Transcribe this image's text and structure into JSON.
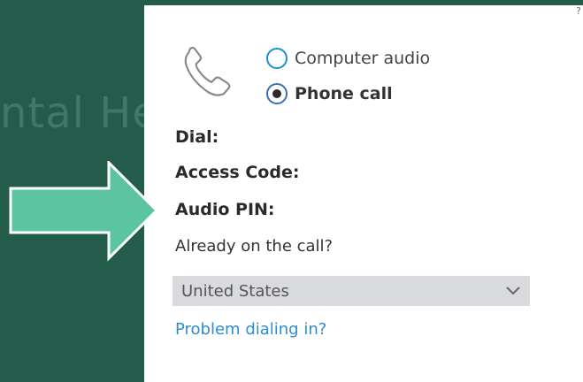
{
  "background": {
    "title_fragment": "ntal He",
    "bottom_fragment": ""
  },
  "audio_options": [
    {
      "label": "Computer audio",
      "checked": false
    },
    {
      "label": "Phone call",
      "checked": true
    }
  ],
  "info": {
    "dial_label": "Dial:",
    "access_code_label": "Access Code:",
    "audio_pin_label": "Audio PIN:",
    "already_on_call": "Already on the call?"
  },
  "country_select": {
    "selected": "United States"
  },
  "problem_link": "Problem dialing in?",
  "colors": {
    "background": "#245c4c",
    "arrow_fill": "#5cc4a0",
    "link": "#2c8dd0",
    "radio_border": "#1a8fd0"
  },
  "icons": [
    "phone-icon",
    "chevron-down-icon",
    "arrow-right-icon"
  ]
}
